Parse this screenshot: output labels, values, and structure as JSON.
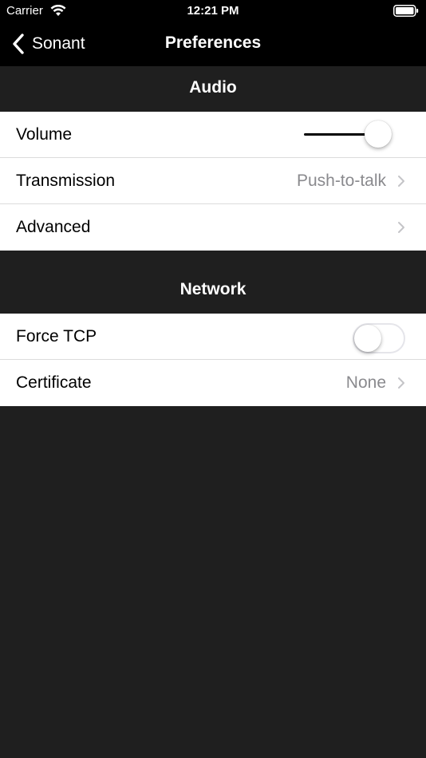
{
  "status_bar": {
    "carrier": "Carrier",
    "time": "12:21 PM"
  },
  "nav": {
    "back_label": "Sonant",
    "title": "Preferences"
  },
  "sections": {
    "audio": {
      "header": "Audio",
      "volume": {
        "label": "Volume",
        "level": 0.83
      },
      "transmission": {
        "label": "Transmission",
        "value": "Push-to-talk"
      },
      "advanced": {
        "label": "Advanced"
      }
    },
    "network": {
      "header": "Network",
      "force_tcp": {
        "label": "Force TCP",
        "enabled": false
      },
      "certificate": {
        "label": "Certificate",
        "value": "None"
      }
    }
  },
  "colors": {
    "background": "#1f1f1f",
    "bar": "#000000",
    "cell": "#ffffff",
    "secondary_text": "#8a8a8e"
  },
  "icons": [
    "wifi-icon",
    "battery-icon",
    "back-chevron-icon",
    "disclosure-chevron-icon"
  ]
}
